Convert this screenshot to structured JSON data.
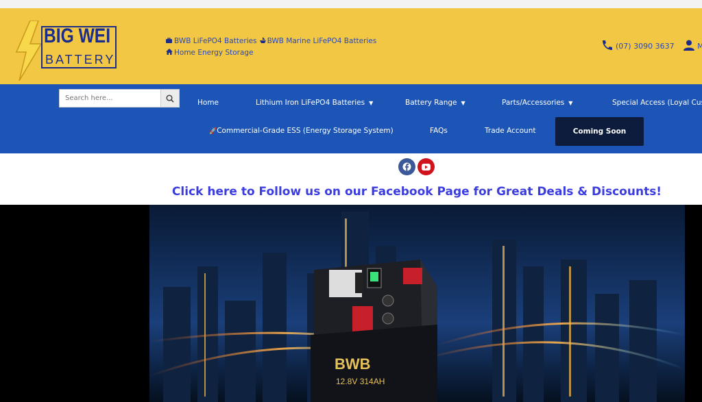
{
  "header": {
    "logo": {
      "line1": "BIG WEI",
      "line2": "BATTERY"
    },
    "links": [
      {
        "icon": "briefcase-icon",
        "label": "BWB LiFePO4 Batteries"
      },
      {
        "icon": "ship-icon",
        "label": "BWB Marine LiFePO4 Batteries"
      },
      {
        "icon": "home-icon",
        "label": "Home Energy Storage"
      }
    ],
    "phone": "(07) 3090 3637",
    "account_label": "My"
  },
  "search": {
    "placeholder": "Search here..."
  },
  "nav": {
    "row1": [
      "Home",
      "Lithium Iron LiFePO4 Batteries",
      "Battery Range",
      "Parts/Accessories",
      "Special Access (Loyal Cus"
    ],
    "row2": [
      "Commercial-Grade ESS (Energy Storage System)",
      "FAQs",
      "Trade Account"
    ],
    "coming_soon": "Coming Soon"
  },
  "social": [
    "facebook-icon",
    "youtube-icon"
  ],
  "follow_text": "Click here to Follow us on our Facebook Page for Great Deals & Discounts!",
  "hero": {
    "battery_brand": "BWB",
    "battery_spec": "12.8V 314AH"
  },
  "colors": {
    "header_yellow": "#f2c744",
    "nav_blue": "#1c55b5",
    "coming_soon_bg": "#0d1c3c",
    "follow_text": "#3b3ce0"
  }
}
